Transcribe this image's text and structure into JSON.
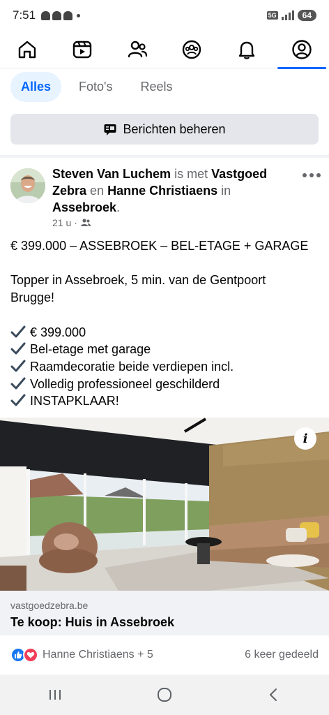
{
  "status_bar": {
    "time": "7:51",
    "network": "5G",
    "battery": "64"
  },
  "nav": {
    "active": "profile",
    "items": [
      "home",
      "video",
      "friends",
      "groups",
      "notifications",
      "profile"
    ]
  },
  "filters": {
    "items": [
      "Alles",
      "Foto's",
      "Reels"
    ],
    "active": "Alles"
  },
  "manage_button": {
    "label": "Berichten beheren"
  },
  "post": {
    "author": "Steven Van Luchem",
    "with_text": "is met",
    "tagged_1": "Vastgoed Zebra",
    "and_text": "en",
    "tagged_2": "Hanne Christiaens",
    "in_text": "in",
    "location": "Assebroek",
    "period": ".",
    "time": "21 u",
    "meta_sep": "·",
    "audience_icon": "friends-icon",
    "body": {
      "line1": "€ 399.000 – ASSEBROEK – BEL-ETAGE + GARAGE",
      "line2": "Topper in Assebroek, 5 min. van de Gentpoort",
      "line3": "Brugge!",
      "checks": [
        "€ 399.000",
        "Bel-etage met garage",
        "Raamdecoratie beide verdiepen incl.",
        "Volledig professioneel geschilderd",
        "INSTAPKLAAR!"
      ]
    }
  },
  "link": {
    "domain": "vastgoedzebra.be",
    "title": "Te koop: Huis in Assebroek"
  },
  "reactions": {
    "names": "Hanne Christiaens + 5",
    "shares": "6 keer gedeeld"
  },
  "colors": {
    "accent": "#0866ff",
    "chip_bg": "#e7f3ff",
    "check_color": "#3a4a5c"
  }
}
